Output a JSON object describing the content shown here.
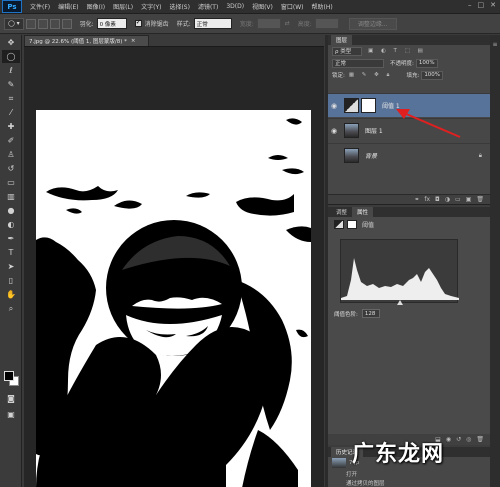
{
  "app": {
    "logo": "Ps",
    "menus": [
      "文件(F)",
      "编辑(E)",
      "图像(I)",
      "图层(L)",
      "文字(Y)",
      "选择(S)",
      "滤镜(T)",
      "3D(D)",
      "视图(V)",
      "窗口(W)",
      "帮助(H)"
    ]
  },
  "options_bar": {
    "feather_label": "羽化:",
    "feather_value": "0 像素",
    "antialias_label": "消除锯齿",
    "style_label": "样式:",
    "style_value": "正常",
    "width_label": "宽度:",
    "height_label": "高度:",
    "refine_button": "调整边缘..."
  },
  "document": {
    "tab_title": "7.jpg @ 22.6% (阈值 1, 图层蒙版/8) *"
  },
  "layers_panel": {
    "tab_label": "图层",
    "kind_select": "ρ 类型",
    "blend_mode": "正常",
    "opacity_label": "不透明度:",
    "opacity_value": "100%",
    "lock_label": "锁定:",
    "fill_label": "填充:",
    "fill_value": "100%",
    "layers": [
      {
        "name": "阈值 1",
        "selected": true
      },
      {
        "name": "图层 1",
        "selected": false
      },
      {
        "name": "背景",
        "selected": false
      }
    ]
  },
  "properties_panel": {
    "tabs": [
      "调整",
      "属性"
    ],
    "title": "阈值",
    "threshold_label": "阈值色阶:",
    "threshold_value": "128"
  },
  "history_panel": {
    "tab_label": "历史记录",
    "snapshot": "7.jp",
    "items": [
      "打开",
      "通过拷贝的图层"
    ]
  },
  "watermark": "广东龙网",
  "colors": {
    "accent_selected_layer": "#587399",
    "annotation_arrow": "#e02020"
  }
}
